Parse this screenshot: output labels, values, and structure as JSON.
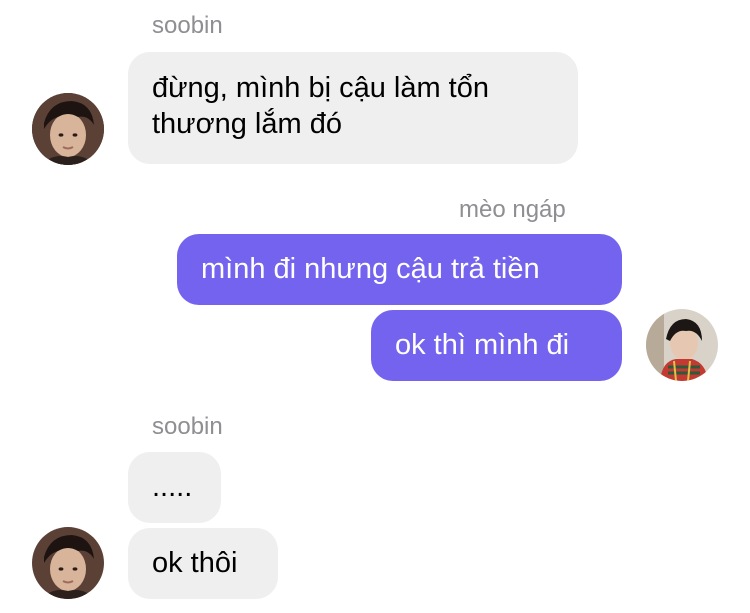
{
  "conversation": {
    "messages": [
      {
        "sender": "soobin",
        "direction": "incoming",
        "text_line1": "đừng, mình bị cậu làm tổn",
        "text_line2": "thương lắm đó"
      },
      {
        "sender": "mèo ngáp",
        "direction": "outgoing",
        "text": "mình đi nhưng cậu trả tiền"
      },
      {
        "sender": "mèo ngáp",
        "direction": "outgoing",
        "text": "ok thì mình đi"
      },
      {
        "sender": "soobin",
        "direction": "incoming",
        "text": "....."
      },
      {
        "sender": "soobin",
        "direction": "incoming",
        "text": "ok thôi"
      }
    ]
  },
  "colors": {
    "outgoing_bubble": "#7463ee",
    "incoming_bubble": "#efefef",
    "sender_name": "#8e8e93"
  },
  "icons": {
    "soobin_avatar": "avatar-photo",
    "meo_ngap_avatar": "avatar-photo"
  }
}
